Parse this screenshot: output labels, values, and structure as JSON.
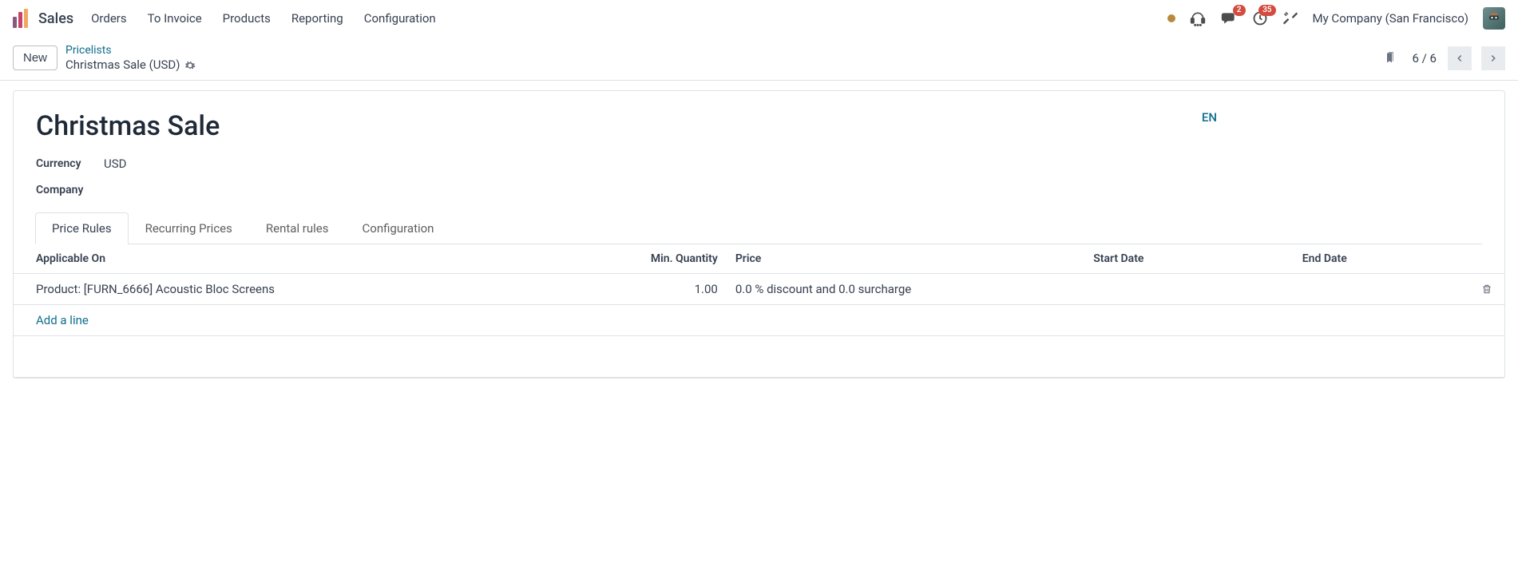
{
  "topbar": {
    "app_name": "Sales",
    "nav": [
      "Orders",
      "To Invoice",
      "Products",
      "Reporting",
      "Configuration"
    ],
    "messages_badge": "2",
    "activities_badge": "35",
    "company": "My Company (San Francisco)"
  },
  "controlbar": {
    "new_label": "New",
    "breadcrumb_parent": "Pricelists",
    "breadcrumb_current": "Christmas Sale (USD)",
    "pager": "6 / 6"
  },
  "form": {
    "title": "Christmas Sale",
    "lang": "EN",
    "fields": {
      "currency_label": "Currency",
      "currency_value": "USD",
      "company_label": "Company",
      "company_value": ""
    },
    "tabs": [
      "Price Rules",
      "Recurring Prices",
      "Rental rules",
      "Configuration"
    ],
    "active_tab": 0,
    "grid": {
      "columns": {
        "applicable_on": "Applicable On",
        "min_qty": "Min. Quantity",
        "price": "Price",
        "start_date": "Start Date",
        "end_date": "End Date"
      },
      "rows": [
        {
          "applicable_on": "Product: [FURN_6666] Acoustic Bloc Screens",
          "min_qty": "1.00",
          "price": "0.0 % discount and 0.0 surcharge",
          "start_date": "",
          "end_date": ""
        }
      ],
      "add_line": "Add a line"
    }
  }
}
